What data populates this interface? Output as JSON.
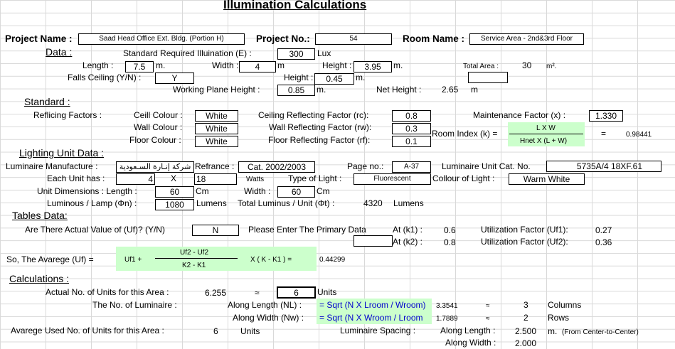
{
  "title": "Illumination Calculations",
  "project": {
    "name_label": "Project Name :",
    "name_value": "Saad Head Office Ext. Bldg. (Portion H)",
    "no_label": "Project No.:",
    "no_value": "54",
    "room_label": "Room Name :",
    "room_value": "Service Area - 2nd&3rd Floor"
  },
  "data": {
    "heading": "Data :",
    "std_illum_label": "Standard Required Illuination (E) :",
    "std_illum_value": "300",
    "std_illum_unit": "Lux",
    "length_label": "Length :",
    "length_value": "7.5",
    "length_unit": "m.",
    "width_label": "Width :",
    "width_value": "4",
    "width_unit": "m",
    "height_label": "Height :",
    "height_value": "3.95",
    "height_unit": "m.",
    "total_area_label": "Total Area :",
    "total_area_value": "30",
    "total_area_unit": "m².",
    "falls_label": "Falls Ceiling (Y/N) :",
    "falls_value": "Y",
    "fc_height_label": "Height :",
    "fc_height_value": "0.45",
    "fc_height_unit": "m.",
    "wp_label": "Working Plane Height :",
    "wp_value": "0.85",
    "wp_unit": "m.",
    "net_label": "Net Height :",
    "net_value": "2.65",
    "net_unit": "m"
  },
  "standard": {
    "heading": "Standard :",
    "refl_label": "Reflicing Factors :",
    "ceil_label": "Ceill Colour :",
    "ceil_value": "White",
    "wall_label": "Wall Colour :",
    "wall_value": "White",
    "floor_label": "Floor Colour :",
    "floor_value": "White",
    "rc_label": "Ceiling Reflecting Factor (rc):",
    "rc_value": "0.8",
    "rw_label": "Wall Reflecting Factor (rw):",
    "rw_value": "0.3",
    "rf_label": "Floor Reflecting Factor (rf):",
    "rf_value": "0.1",
    "mf_label": "Maintenance Factor (x) :",
    "mf_value": "1.330",
    "ri_label": "Room Index (k) =",
    "ri_num": "L X W",
    "ri_den": "Hnet X (L + W)",
    "ri_eq": "=",
    "ri_value": "0.98441"
  },
  "lighting": {
    "heading": "Lighting Unit Data :",
    "manu_label": "Luminaire Manufacture :",
    "manu_value": "شركة إنـارة السـعودية",
    "ref_label": "Refrance :",
    "ref_value": "Cat. 2002/2003",
    "page_label": "Page no.:",
    "page_value": "A-37",
    "cat_label": "Luminaire Unit Cat. No.",
    "cat_value": "5735A/4 18XF.61",
    "each_label": "Each Unit has :",
    "each_count": "4",
    "each_x": "X",
    "each_watts": "18",
    "watts_label": "Watts",
    "type_label": "Type of Light :",
    "type_value": "Fluorescent",
    "colour_label": "Collour of Light :",
    "colour_value": "Warm White",
    "dim_label": "Unit Dimensions : Length :",
    "dim_length": "60",
    "dim_unit": "Cm",
    "dim_width_label": "Width :",
    "dim_width": "60",
    "dim_width_unit": "Cm",
    "lum_label": "Luminous / Lamp (Φn) :",
    "lum_value": "1080",
    "lum_unit": "Lumens",
    "total_lum_label": "Total Luminus / Unit (Φt) :",
    "total_lum_value": "4320",
    "total_lum_unit": "Lumens"
  },
  "tables": {
    "heading": "Tables Data:",
    "uf_q": "Are There Actual Value of (Uf)? (Y/N)",
    "uf_ans": "N",
    "primary_label": "Please Enter The Primary Data",
    "k1_label": "At (k1) :",
    "k1_value": "0.6",
    "k2_label": "At (k2) :",
    "k2_value": "0.8",
    "uf1_label": "Utilization Factor (Uf1):",
    "uf1_value": "0.27",
    "uf2_label": "Utilization Factor (Uf2):",
    "uf2_value": "0.36",
    "avg_label": "So, The Avarege (Uf) =",
    "avg_uf1": "Uf1 +",
    "avg_num": "Uf2 - Uf2",
    "avg_den": "K2 - K1",
    "avg_mult": "X ( K - K1 )  =",
    "avg_value": "0.44299"
  },
  "calc": {
    "heading": "Calculations :",
    "actual_label": "Actual No. of Units for this Area :",
    "actual_value": "6.255",
    "approx": "≈",
    "units_value": "6",
    "units_label": "Units",
    "nolum_label": "The No. of Luminaire :",
    "along_len_label": "Along Length (NL) :",
    "along_len_formula": "= Sqrt  (N X Lroom / Wroom)",
    "along_len_value": "3.3541",
    "along_len_round": "3",
    "columns": "Columns",
    "along_wid_label": "Along Width (Nw) :",
    "along_wid_formula": "= Sqrt  (N X Wroom / Lroom",
    "along_wid_value": "1.7889",
    "along_wid_round": "2",
    "rows": "Rows",
    "used_label": "Avarege Used No. of Units for this Area :",
    "used_value": "6",
    "used_unit": "Units",
    "spacing_label": "Luminaire Spacing :",
    "sp_len_label": "Along Length :",
    "sp_len_value": "2.500",
    "sp_len_unit": "m.",
    "sp_len_note": "(From Center-to-Center)",
    "sp_wid_label": "Along Width :",
    "sp_wid_value": "2.000"
  }
}
